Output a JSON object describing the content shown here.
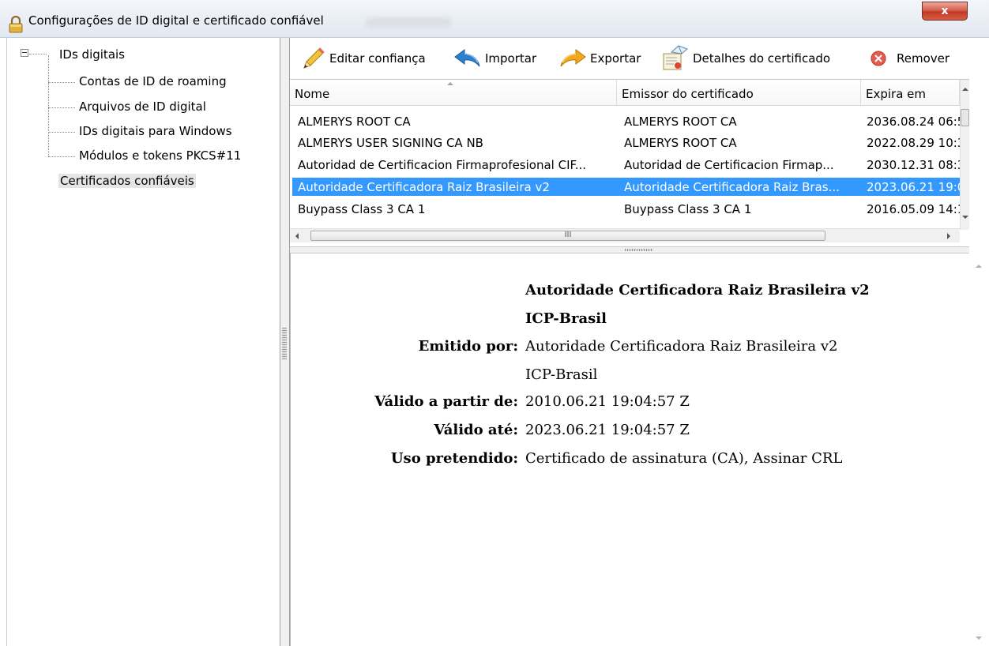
{
  "window": {
    "title": "Configurações de ID digital e certificado confiável",
    "close_label": "x"
  },
  "tree": {
    "root_label": "IDs digitais",
    "children": [
      "Contas de ID de roaming",
      "Arquivos de ID digital",
      "IDs digitais para Windows",
      "Módulos e tokens PKCS#11"
    ],
    "selected_label": "Certificados confiáveis"
  },
  "toolbar": {
    "edit_trust": "Editar confiança",
    "import": "Importar",
    "export": "Exportar",
    "details": "Detalhes do certificado",
    "remove": "Remover"
  },
  "list": {
    "columns": [
      "Nome",
      "Emissor do certificado",
      "Expira em"
    ],
    "rows": [
      [
        "ALMERYS ROOT CA",
        "ALMERYS ROOT CA",
        "2036.08.24 06:5"
      ],
      [
        "ALMERYS USER SIGNING CA NB",
        "ALMERYS ROOT CA",
        "2022.08.29 10:3"
      ],
      [
        "Autoridad de Certificacion Firmaprofesional CIF...",
        "Autoridad de Certificacion Firmap...",
        "2030.12.31 08:3"
      ],
      [
        "Autoridade Certificadora Raiz Brasileira v2",
        "Autoridade Certificadora Raiz Bras...",
        "2023.06.21 19:0"
      ],
      [
        "Buypass Class 3 CA 1",
        "Buypass Class 3 CA 1",
        "2016.05.09 14:1"
      ]
    ],
    "selected_index": 3,
    "scroll_grip": "III"
  },
  "detail": {
    "subject_line1": "Autoridade Certificadora Raiz Brasileira v2",
    "subject_line2": "ICP-Brasil",
    "issued_by_label": "Emitido por:",
    "issued_by_line1": "Autoridade Certificadora Raiz Brasileira v2",
    "issued_by_line2": "ICP-Brasil",
    "valid_from_label": "Válido a partir de:",
    "valid_from": "2010.06.21 19:04:57 Z",
    "valid_to_label": "Válido até:",
    "valid_to": "2023.06.21 19:04:57 Z",
    "usage_label": "Uso pretendido:",
    "usage": "Certificado de assinatura (CA), Assinar CRL"
  },
  "colors": {
    "selection": "#3399ff",
    "close_button": "#c23a25"
  },
  "icons": {
    "title": "lock-icon",
    "edit_trust": "pencil-icon",
    "import": "arrow-left-icon",
    "export": "arrow-right-icon",
    "details": "certificate-icon",
    "remove": "remove-icon"
  }
}
